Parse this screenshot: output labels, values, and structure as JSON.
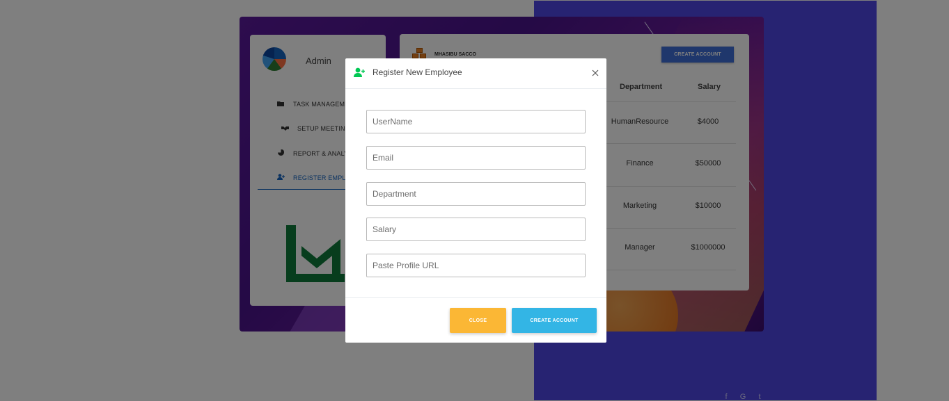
{
  "sidebar": {
    "admin_name": "Admin",
    "items": [
      {
        "label": "TASK MANAGEME",
        "icon": "folder-icon"
      },
      {
        "label": "SETUP MEETING",
        "icon": "handshake-icon"
      },
      {
        "label": "REPORT & ANALYS",
        "icon": "pie-chart-icon"
      },
      {
        "label": "REGISTER EMPLOY",
        "icon": "user-plus-icon",
        "active": true
      }
    ]
  },
  "main": {
    "brand": "MHASIBU SACCO",
    "create_account_label": "CREATE ACCOUNT",
    "table": {
      "headers": [
        "Department",
        "Salary"
      ],
      "rows": [
        {
          "department": "HumanResource",
          "salary": "$4000"
        },
        {
          "department": "Finance",
          "salary": "$50000"
        },
        {
          "department": "Marketing",
          "salary": "$10000"
        },
        {
          "department": "Manager",
          "salary": "$1000000"
        }
      ]
    }
  },
  "modal": {
    "title": "Register New Employee",
    "fields": {
      "username": "UserName",
      "email": "Email",
      "department": "Department",
      "salary": "Salary",
      "profile_url": "Paste Profile URL"
    },
    "close_label": "CLOSE",
    "create_label": "CREATE ACCOUNT"
  },
  "colors": {
    "accent_blue": "#3f6fd8",
    "close_button": "#fbb735",
    "create_button": "#33b5e5",
    "icon_green": "#00c853",
    "right_panel": "#4f46e5"
  }
}
